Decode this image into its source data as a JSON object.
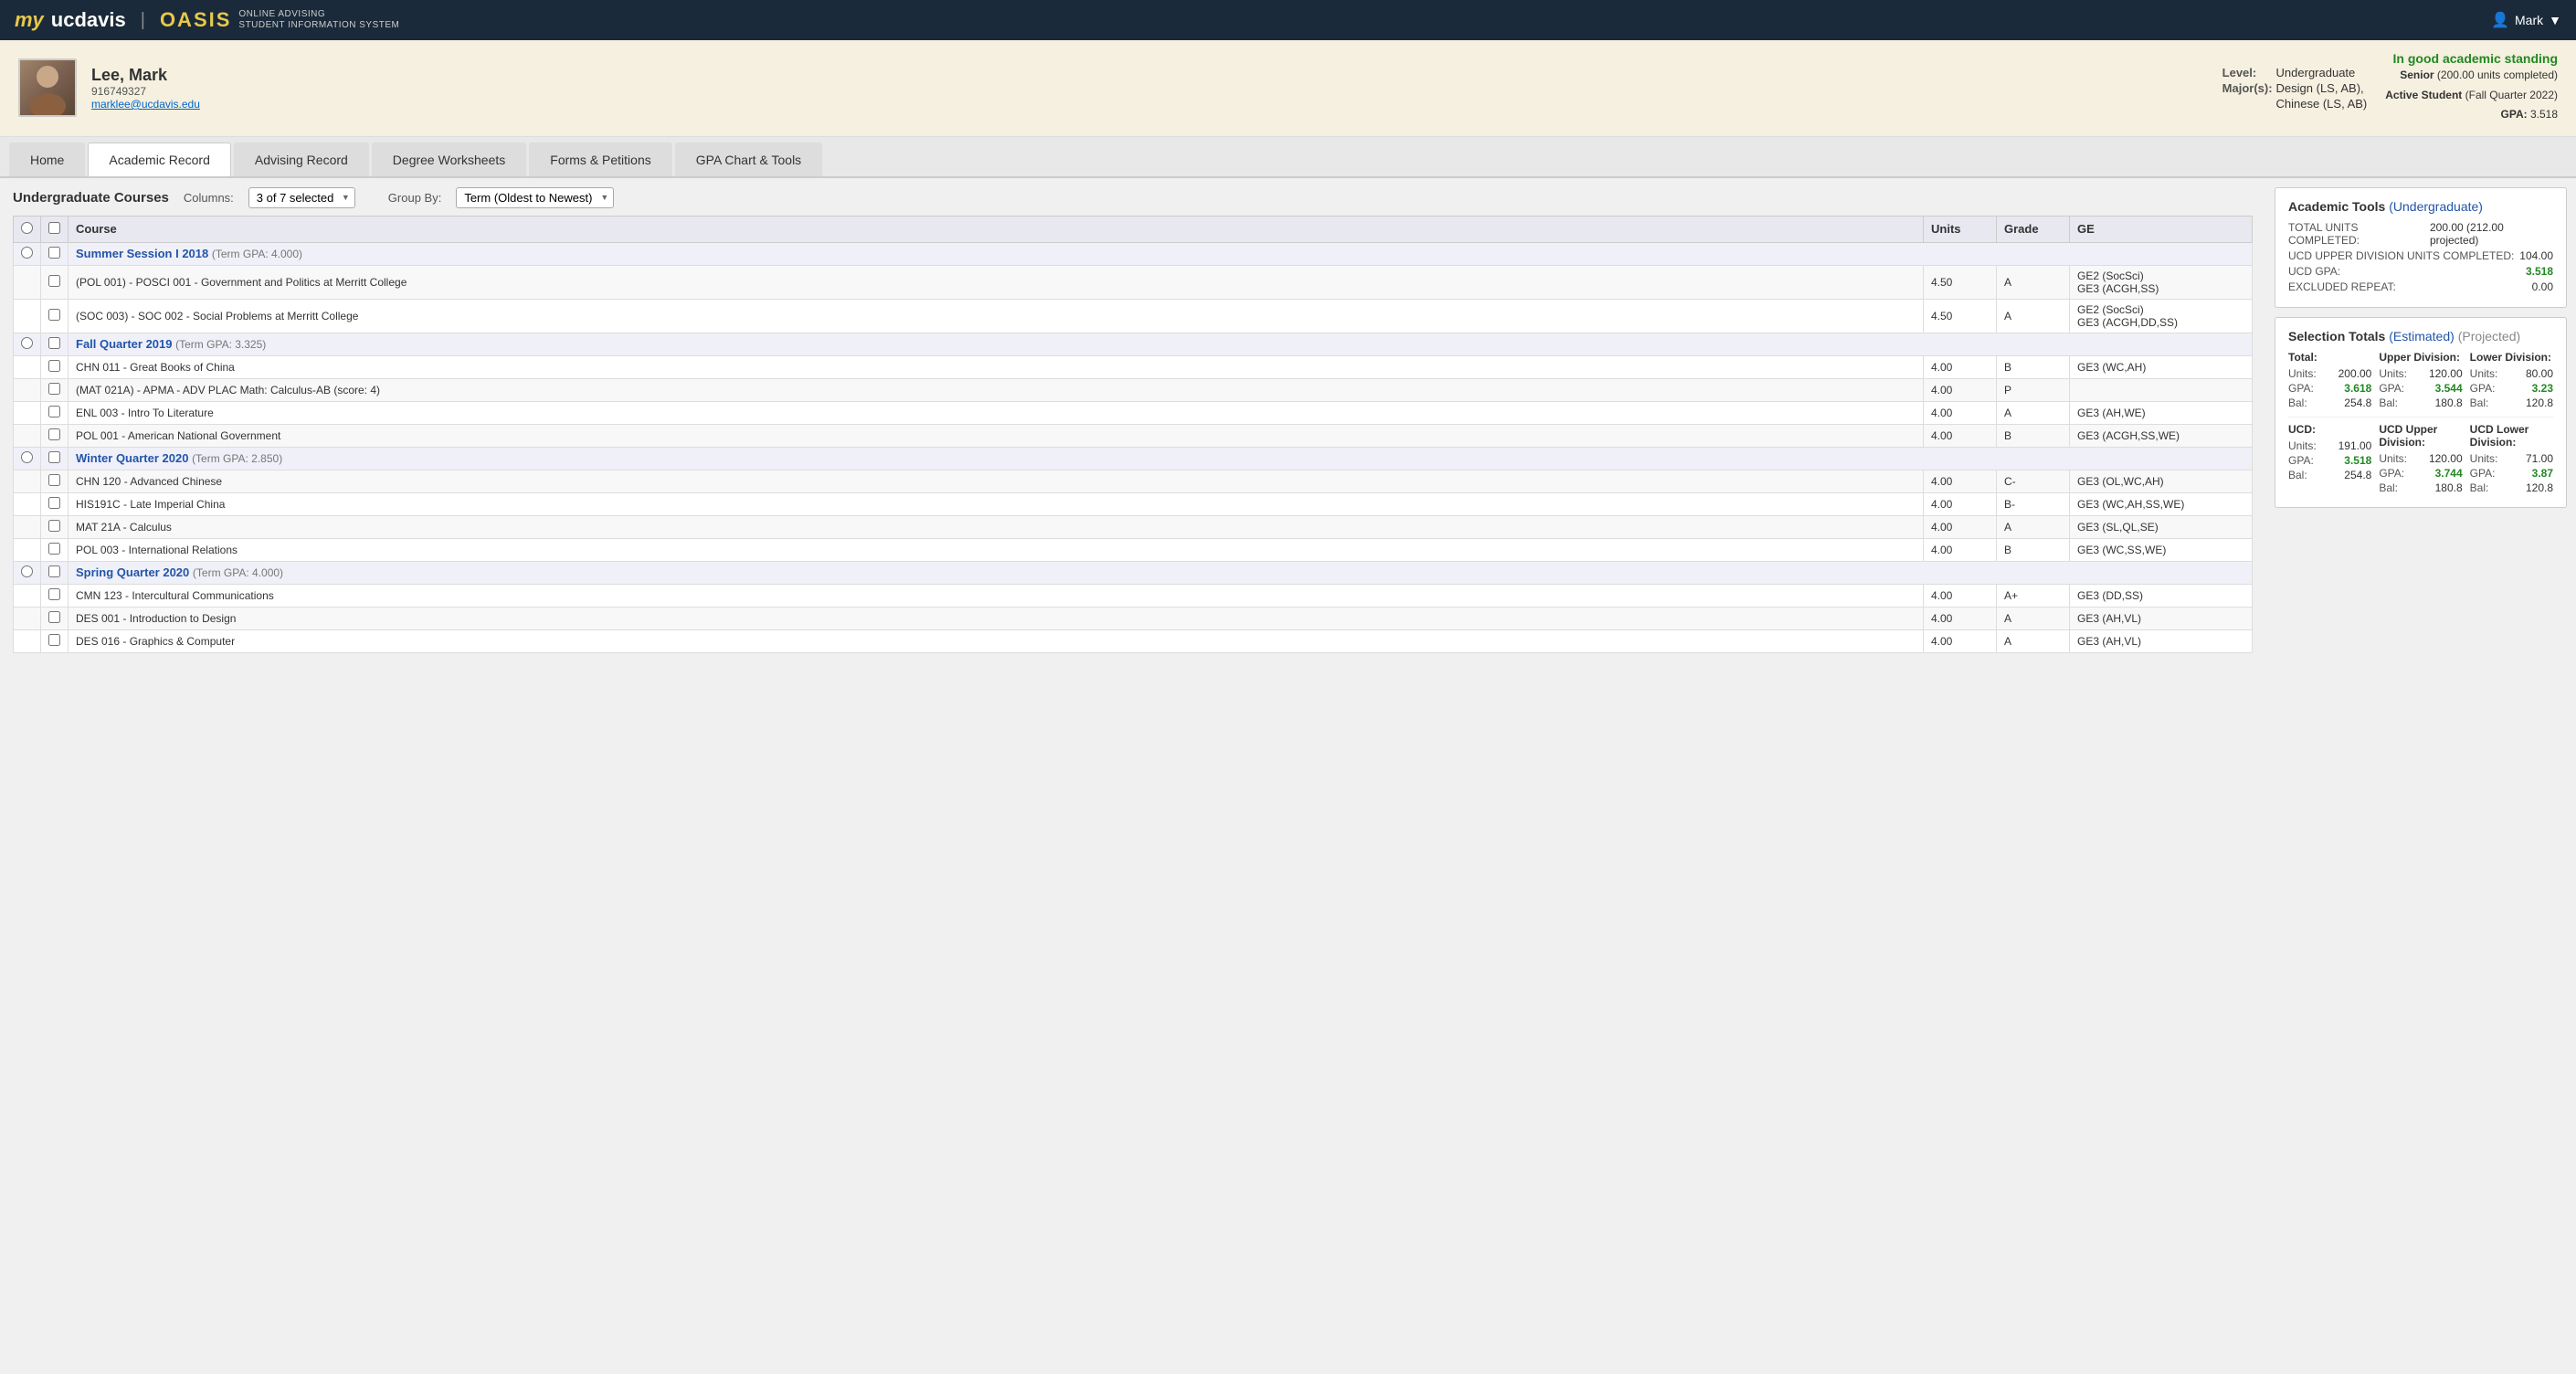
{
  "topbar": {
    "logo_my": "my",
    "logo_ucdavis": "ucdavis",
    "logo_divider": "|",
    "logo_oasis": "OASIS",
    "logo_subtitle_line1": "Online Advising",
    "logo_subtitle_line2": "Student Information System",
    "user_label": "Mark",
    "user_icon": "👤"
  },
  "student": {
    "name": "Lee, Mark",
    "id": "916749327",
    "email": "marklee@ucdavis.edu",
    "level_label": "Level:",
    "level_value": "Undergraduate",
    "major_label": "Major(s):",
    "major_value1": "Design (LS, AB),",
    "major_value2": "Chinese (LS, AB)",
    "standing": "In good academic standing",
    "rank": "Senior",
    "rank_detail": "(200.00 units completed)",
    "active_student": "Active Student",
    "active_detail": "(Fall Quarter 2022)",
    "gpa_label": "GPA:",
    "gpa_value": "3.518"
  },
  "nav": {
    "tabs": [
      {
        "label": "Home",
        "active": false
      },
      {
        "label": "Academic Record",
        "active": true
      },
      {
        "label": "Advising Record",
        "active": false
      },
      {
        "label": "Degree Worksheets",
        "active": false
      },
      {
        "label": "Forms & Petitions",
        "active": false
      },
      {
        "label": "GPA Chart & Tools",
        "active": false
      }
    ]
  },
  "courses_section": {
    "title": "Undergraduate Courses",
    "columns_label": "Columns:",
    "columns_value": "3 of 7 selected",
    "groupby_label": "Group By:",
    "groupby_value": "Term (Oldest to Newest)",
    "table_headers": {
      "course": "Course",
      "units": "Units",
      "grade": "Grade",
      "ge": "GE"
    },
    "terms": [
      {
        "term_name": "Summer Session I 2018",
        "term_gpa": "(Term GPA: 4.000)",
        "courses": [
          {
            "course": "(POL 001) - POSCI 001 - Government and Politics at Merritt College",
            "units": "4.50",
            "grade": "A",
            "ge": "GE2 (SocSci)\nGE3 (ACGH,SS)"
          },
          {
            "course": "(SOC 003) - SOC 002 - Social Problems at Merritt College",
            "units": "4.50",
            "grade": "A",
            "ge": "GE2 (SocSci)\nGE3 (ACGH,DD,SS)"
          }
        ]
      },
      {
        "term_name": "Fall Quarter 2019",
        "term_gpa": "(Term GPA: 3.325)",
        "courses": [
          {
            "course": "CHN 011 - Great Books of China",
            "units": "4.00",
            "grade": "B",
            "ge": "GE3 (WC,AH)"
          },
          {
            "course": "(MAT 021A) - APMA - ADV PLAC Math: Calculus-AB (score: 4)",
            "units": "4.00",
            "grade": "P",
            "ge": ""
          },
          {
            "course": "ENL 003 - Intro To Literature",
            "units": "4.00",
            "grade": "A",
            "ge": "GE3 (AH,WE)"
          },
          {
            "course": "POL 001 - American National Government",
            "units": "4.00",
            "grade": "B",
            "ge": "GE3 (ACGH,SS,WE)"
          }
        ]
      },
      {
        "term_name": "Winter Quarter 2020",
        "term_gpa": "(Term GPA: 2.850)",
        "courses": [
          {
            "course": "CHN 120 - Advanced Chinese",
            "units": "4.00",
            "grade": "C-",
            "ge": "GE3 (OL,WC,AH)"
          },
          {
            "course": "HIS191C - Late Imperial China",
            "units": "4.00",
            "grade": "B-",
            "ge": "GE3 (WC,AH,SS,WE)"
          },
          {
            "course": "MAT 21A - Calculus",
            "units": "4.00",
            "grade": "A",
            "ge": "GE3 (SL,QL,SE)"
          },
          {
            "course": "POL 003 - International Relations",
            "units": "4.00",
            "grade": "B",
            "ge": "GE3 (WC,SS,WE)"
          }
        ]
      },
      {
        "term_name": "Spring Quarter 2020",
        "term_gpa": "(Term GPA: 4.000)",
        "courses": [
          {
            "course": "CMN 123 - Intercultural Communications",
            "units": "4.00",
            "grade": "A+",
            "ge": "GE3 (DD,SS)"
          },
          {
            "course": "DES 001 - Introduction to Design",
            "units": "4.00",
            "grade": "A",
            "ge": "GE3 (AH,VL)"
          },
          {
            "course": "DES 016 - Graphics & Computer",
            "units": "4.00",
            "grade": "A",
            "ge": "GE3 (AH,VL)"
          }
        ]
      }
    ]
  },
  "academic_tools": {
    "title": "Academic Tools",
    "subtitle": "(Undergraduate)",
    "total_units_label": "TOTAL UNITS COMPLETED:",
    "total_units_value": "200.00",
    "total_units_projected": "(212.00 projected)",
    "upper_div_label": "UCD UPPER DIVISION UNITS COMPLETED:",
    "upper_div_value": "104.00",
    "gpa_label": "UCD GPA:",
    "gpa_value": "3.518",
    "excluded_label": "EXCLUDED REPEAT:",
    "excluded_value": "0.00"
  },
  "selection_totals": {
    "title": "Selection Totals",
    "subtitle": "(Estimated)",
    "projected": "(Projected)",
    "total_header": "Total:",
    "upper_header": "Upper Division:",
    "lower_header": "Lower Division:",
    "total": {
      "units_label": "Units:",
      "units_value": "200.00",
      "gpa_label": "GPA:",
      "gpa_value": "3.618",
      "bal_label": "Bal:",
      "bal_value": "254.8"
    },
    "upper": {
      "units_label": "Units:",
      "units_value": "120.00",
      "gpa_label": "GPA:",
      "gpa_value": "3.544",
      "bal_label": "Bal:",
      "bal_value": "180.8"
    },
    "lower": {
      "units_label": "Units:",
      "units_value": "80.00",
      "gpa_label": "GPA:",
      "gpa_value": "3.23",
      "bal_label": "Bal:",
      "bal_value": "120.8"
    },
    "ucd_header": "UCD:",
    "ucd_upper_header": "UCD Upper Division:",
    "ucd_lower_header": "UCD Lower Division:",
    "ucd": {
      "units_label": "Units:",
      "units_value": "191.00",
      "gpa_label": "GPA:",
      "gpa_value": "3.518",
      "bal_label": "Bal:",
      "bal_value": "254.8"
    },
    "ucd_upper": {
      "units_label": "Units:",
      "units_value": "120.00",
      "gpa_label": "GPA:",
      "gpa_value": "3.744",
      "bal_label": "Bal:",
      "bal_value": "180.8"
    },
    "ucd_lower": {
      "units_label": "Units:",
      "units_value": "71.00",
      "gpa_label": "GPA:",
      "gpa_value": "3.87",
      "bal_label": "Bal:",
      "bal_value": "120.8"
    }
  }
}
